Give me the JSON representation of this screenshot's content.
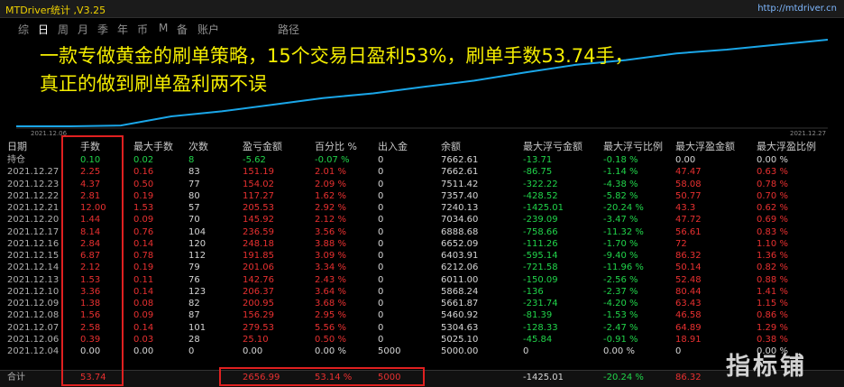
{
  "window": {
    "title": "MTDriver统计 ,V3.25",
    "url": "http://mtdriver.cn"
  },
  "toolbar": {
    "items": [
      "综",
      "日",
      "周",
      "月",
      "季",
      "年",
      "币",
      "M",
      "备",
      "账户",
      "路径"
    ],
    "active": "日"
  },
  "chart_data": {
    "type": "line",
    "x_start_label": "2021.12.06",
    "x_end_label": "2021.12.27",
    "series": [
      {
        "values": [
          5000,
          5025.1,
          5304.63,
          5460.92,
          5661.87,
          5868.24,
          6011.0,
          6212.06,
          6403.91,
          6652.09,
          6888.68,
          7034.6,
          7240.13,
          7357.4,
          7511.42,
          7662.61
        ]
      }
    ],
    "line_color": "#1aa6e8",
    "grid": false
  },
  "overlay": {
    "line1": "一款专做黄金的刷单策略，15个交易日盈利53%，刷单手数53.74手，",
    "line2": "真正的做到刷单盈利两不误"
  },
  "table": {
    "headers": [
      "日期",
      "手数",
      "最大手数",
      "次数",
      "盈亏金额",
      "百分比 %",
      "出入金",
      "余额",
      "最大浮亏金额",
      "最大浮亏比例",
      "最大浮盈金额",
      "最大浮盈比例"
    ],
    "holding": {
      "label": "持仓",
      "values": [
        "0.10",
        "0.02",
        "8",
        "-5.62",
        "-0.07 %",
        "0",
        "7662.61",
        "-13.71",
        "-0.18 %",
        "0.00",
        "0.00 %"
      ]
    },
    "rows": [
      {
        "date": "2021.12.27",
        "values": [
          "2.25",
          "0.16",
          "83",
          "151.19",
          "2.01 %",
          "0",
          "7662.61",
          "-86.75",
          "-1.14 %",
          "47.47",
          "0.63 %"
        ]
      },
      {
        "date": "2021.12.23",
        "values": [
          "4.37",
          "0.50",
          "77",
          "154.02",
          "2.09 %",
          "0",
          "7511.42",
          "-322.22",
          "-4.38 %",
          "58.08",
          "0.78 %"
        ]
      },
      {
        "date": "2021.12.22",
        "values": [
          "2.81",
          "0.19",
          "80",
          "117.27",
          "1.62 %",
          "0",
          "7357.40",
          "-428.52",
          "-5.82 %",
          "50.77",
          "0.70 %"
        ]
      },
      {
        "date": "2021.12.21",
        "values": [
          "12.00",
          "1.53",
          "57",
          "205.53",
          "2.92 %",
          "0",
          "7240.13",
          "-1425.01",
          "-20.24 %",
          "43.3",
          "0.62 %"
        ]
      },
      {
        "date": "2021.12.20",
        "values": [
          "1.44",
          "0.09",
          "70",
          "145.92",
          "2.12 %",
          "0",
          "7034.60",
          "-239.09",
          "-3.47 %",
          "47.72",
          "0.69 %"
        ]
      },
      {
        "date": "2021.12.17",
        "values": [
          "8.14",
          "0.76",
          "104",
          "236.59",
          "3.56 %",
          "0",
          "6888.68",
          "-758.66",
          "-11.32 %",
          "56.61",
          "0.83 %"
        ]
      },
      {
        "date": "2021.12.16",
        "values": [
          "2.84",
          "0.14",
          "120",
          "248.18",
          "3.88 %",
          "0",
          "6652.09",
          "-111.26",
          "-1.70 %",
          "72",
          "1.10 %"
        ]
      },
      {
        "date": "2021.12.15",
        "values": [
          "6.87",
          "0.78",
          "112",
          "191.85",
          "3.09 %",
          "0",
          "6403.91",
          "-595.14",
          "-9.40 %",
          "86.32",
          "1.36 %"
        ]
      },
      {
        "date": "2021.12.14",
        "values": [
          "2.12",
          "0.19",
          "79",
          "201.06",
          "3.34 %",
          "0",
          "6212.06",
          "-721.58",
          "-11.96 %",
          "50.14",
          "0.82 %"
        ]
      },
      {
        "date": "2021.12.13",
        "values": [
          "1.53",
          "0.11",
          "76",
          "142.76",
          "2.43 %",
          "0",
          "6011.00",
          "-150.09",
          "-2.56 %",
          "52.48",
          "0.88 %"
        ]
      },
      {
        "date": "2021.12.10",
        "values": [
          "3.36",
          "0.14",
          "123",
          "206.37",
          "3.64 %",
          "0",
          "5868.24",
          "-136",
          "-2.37 %",
          "80.44",
          "1.41 %"
        ]
      },
      {
        "date": "2021.12.09",
        "values": [
          "1.38",
          "0.08",
          "82",
          "200.95",
          "3.68 %",
          "0",
          "5661.87",
          "-231.74",
          "-4.20 %",
          "63.43",
          "1.15 %"
        ]
      },
      {
        "date": "2021.12.08",
        "values": [
          "1.56",
          "0.09",
          "87",
          "156.29",
          "2.95 %",
          "0",
          "5460.92",
          "-81.39",
          "-1.53 %",
          "46.58",
          "0.86 %"
        ]
      },
      {
        "date": "2021.12.07",
        "values": [
          "2.58",
          "0.14",
          "101",
          "279.53",
          "5.56 %",
          "0",
          "5304.63",
          "-128.33",
          "-2.47 %",
          "64.89",
          "1.29 %"
        ]
      },
      {
        "date": "2021.12.06",
        "values": [
          "0.39",
          "0.03",
          "28",
          "25.10",
          "0.50 %",
          "0",
          "5025.10",
          "-45.84",
          "-0.91 %",
          "18.91",
          "0.38 %"
        ]
      },
      {
        "date": "2021.12.04",
        "values": [
          "0.00",
          "0.00",
          "0",
          "0.00",
          "0.00 %",
          "5000",
          "5000.00",
          "0",
          "0.00 %",
          "0",
          "0.00 %"
        ]
      }
    ],
    "total": {
      "label": "合计",
      "values": [
        "53.74",
        "",
        "",
        "2656.99",
        "53.14 %",
        "5000",
        "",
        "-1425.01",
        "-20.24 %",
        "86.32",
        ""
      ]
    }
  },
  "colors": {
    "positive": "#e83030",
    "negative": "#21d44a",
    "neutral": "#d6d6d6",
    "highlight_box": "#e02020",
    "overlay_text": "#f5ee00"
  },
  "watermark": "指标铺"
}
